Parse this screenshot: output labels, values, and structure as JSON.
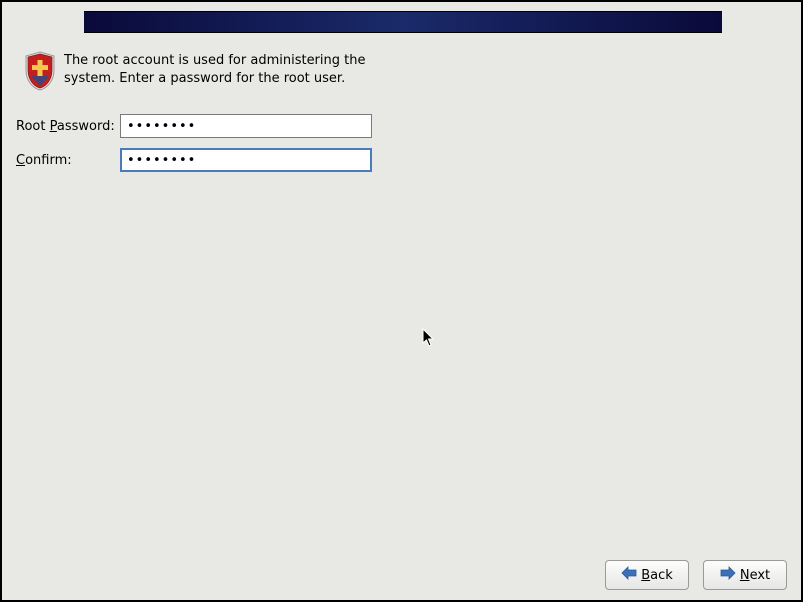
{
  "info": {
    "text": "The root account is used for administering the system.  Enter a password for the root user."
  },
  "form": {
    "password_label_pre": "Root ",
    "password_label_ul": "P",
    "password_label_post": "assword:",
    "confirm_label_ul": "C",
    "confirm_label_post": "onfirm:",
    "password_value": "••••••••",
    "confirm_value": "••••••••"
  },
  "buttons": {
    "back_ul": "B",
    "back_rest": "ack",
    "next_ul": "N",
    "next_rest": "ext"
  },
  "colors": {
    "banner_dark": "#0a0a3a",
    "banner_mid": "#1a2a6a",
    "focus": "#4a7bbd"
  }
}
